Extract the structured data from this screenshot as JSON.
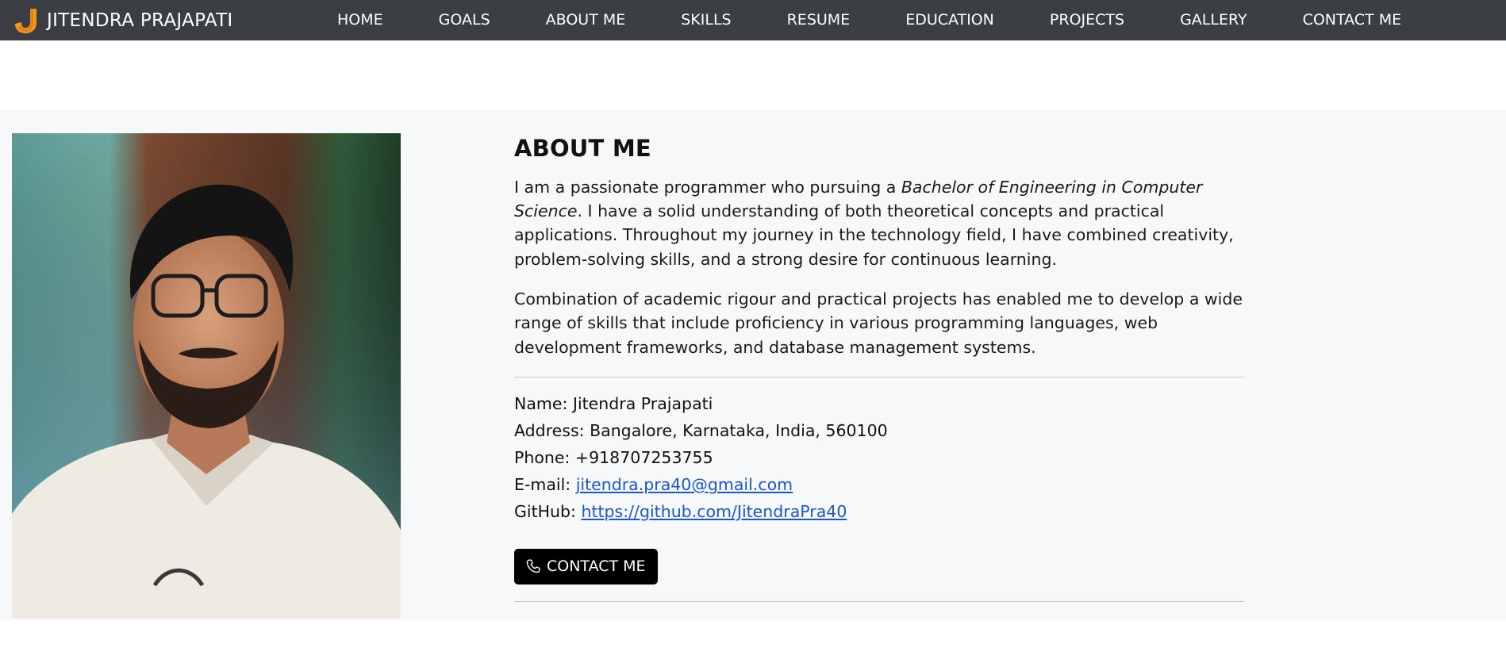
{
  "nav": {
    "brand": "JITENDRA PRAJAPATI",
    "links": [
      "HOME",
      "GOALS",
      "ABOUT ME",
      "SKILLS",
      "RESUME",
      "EDUCATION",
      "PROJECTS",
      "GALLERY",
      "CONTACT ME"
    ]
  },
  "about": {
    "title": "ABOUT ME",
    "para1_pre": "I am a passionate programmer who pursuing a ",
    "para1_em": "Bachelor of Engineering in Computer Science",
    "para1_post": ". I have a solid understanding of both theoretical concepts and practical applications. Throughout my journey in the technology field, I have combined creativity, problem-solving skills, and a strong desire for continuous learning.",
    "para2": "Combination of academic rigour and practical projects has enabled me to develop a wide range of skills that include proficiency in various programming languages, web development frameworks, and database management systems.",
    "info": {
      "name": "Name: Jitendra Prajapati",
      "address": "Address: Bangalore, Karnataka, India, 560100",
      "phone": "Phone: +918707253755",
      "email_label": "E-mail: ",
      "email": "jitendra.pra40@gmail.com",
      "github_label": "GitHub: ",
      "github": "https://github.com/JitendraPra40"
    },
    "contact_button": "CONTACT ME"
  },
  "colors": {
    "navbar": "#3b3f43",
    "section_bg": "#f7f8fa",
    "link": "#1a56db",
    "button": "#000000",
    "logo_orange": "#f39c12"
  },
  "icons": {
    "logo": "j-logo-icon",
    "button": "phone-icon"
  }
}
